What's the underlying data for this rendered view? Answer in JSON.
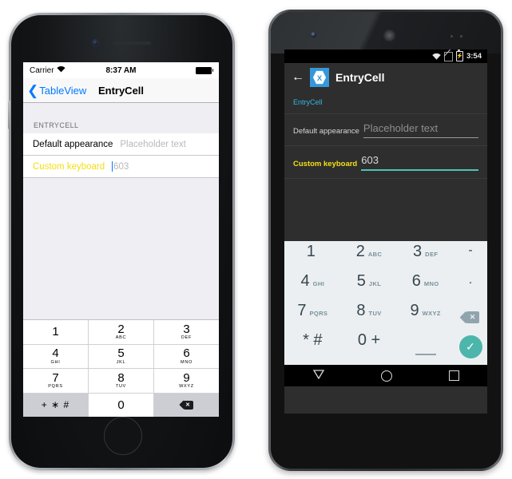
{
  "ios": {
    "status": {
      "carrier": "Carrier",
      "wifi_icon": "wifi-icon",
      "time": "8:37 AM",
      "battery_icon": "battery-full-icon"
    },
    "nav": {
      "back_label": "TableView",
      "back_chevron": "chevron-left-icon",
      "title": "EntryCell"
    },
    "section_header": "ENTRYCELL",
    "rows": [
      {
        "label": "Default appearance",
        "value": "Placeholder text",
        "is_placeholder": true,
        "has_caret": false
      },
      {
        "label": "Custom keyboard",
        "value": "603",
        "is_placeholder": true,
        "has_caret": true
      }
    ],
    "keyboard": {
      "rows": [
        [
          {
            "num": "1",
            "sub": ""
          },
          {
            "num": "2",
            "sub": "ABC"
          },
          {
            "num": "3",
            "sub": "DEF"
          }
        ],
        [
          {
            "num": "4",
            "sub": "GHI"
          },
          {
            "num": "5",
            "sub": "JKL"
          },
          {
            "num": "6",
            "sub": "MNO"
          }
        ],
        [
          {
            "num": "7",
            "sub": "PQRS"
          },
          {
            "num": "8",
            "sub": "TUV"
          },
          {
            "num": "9",
            "sub": "WXYZ"
          }
        ]
      ],
      "bottom": {
        "symbols": "+ ∗ #",
        "zero": "0",
        "backspace_icon": "backspace-icon",
        "backspace_glyph": "✕"
      }
    }
  },
  "android": {
    "status": {
      "wifi_icon": "wifi-icon",
      "sim_icon": "no-sim-icon",
      "battery_icon": "battery-charging-icon",
      "battery_glyph": "⚡",
      "time": "3:54"
    },
    "appbar": {
      "back_icon": "arrow-left-icon",
      "logo_icon": "xamarin-logo-icon",
      "title": "EntryCell"
    },
    "section_label": "EntryCell",
    "fields": [
      {
        "label": "Default appearance",
        "value": "Placeholder text",
        "is_placeholder": true,
        "focused": false
      },
      {
        "label": "Custom keyboard",
        "value": "603",
        "is_placeholder": false,
        "focused": true
      }
    ],
    "keyboard": {
      "rows": [
        [
          {
            "num": "1",
            "sub": ""
          },
          {
            "num": "2",
            "sub": "ABC"
          },
          {
            "num": "3",
            "sub": "DEF"
          },
          {
            "sym": "-"
          }
        ],
        [
          {
            "num": "4",
            "sub": "GHI"
          },
          {
            "num": "5",
            "sub": "JKL"
          },
          {
            "num": "6",
            "sub": "MNO"
          },
          {
            "sym": "."
          }
        ],
        [
          {
            "num": "7",
            "sub": "PQRS"
          },
          {
            "num": "8",
            "sub": "TUV"
          },
          {
            "num": "9",
            "sub": "WXYZ"
          },
          {
            "icon": "backspace-icon",
            "glyph": "✕"
          }
        ],
        [
          {
            "sym": "* #"
          },
          {
            "sym": "0 +"
          },
          {
            "icon": "space-icon"
          },
          {
            "icon": "check-icon",
            "glyph": "✓"
          }
        ]
      ]
    },
    "navbar": {
      "back_icon": "nav-back-triangle-icon",
      "home_icon": "nav-home-circle-icon",
      "recents_icon": "nav-recents-square-icon"
    }
  },
  "colors": {
    "ios_accent": "#007aff",
    "ios_custom_label": "#f2e014",
    "android_accent": "#33b5e5",
    "android_teal": "#4db6ac",
    "xamarin_blue": "#3498db"
  }
}
